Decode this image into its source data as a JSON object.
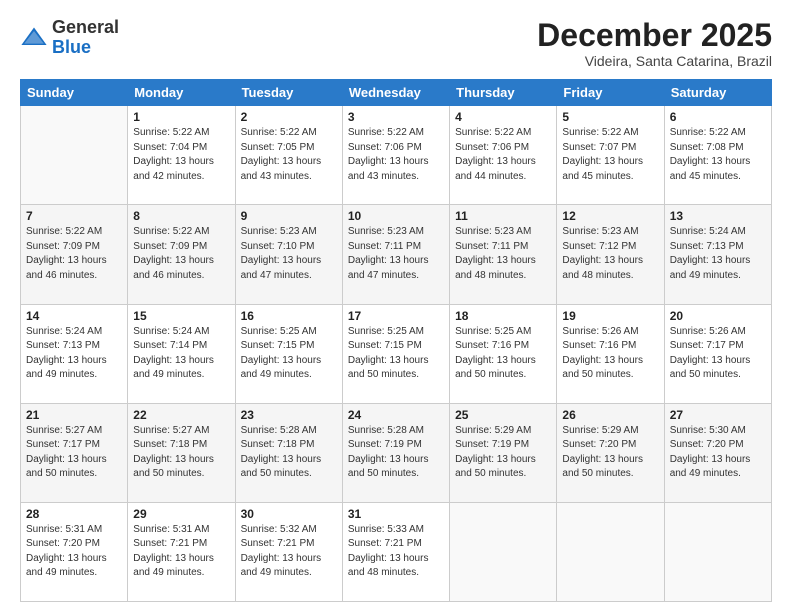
{
  "header": {
    "logo_general": "General",
    "logo_blue": "Blue",
    "month": "December 2025",
    "location": "Videira, Santa Catarina, Brazil"
  },
  "weekdays": [
    "Sunday",
    "Monday",
    "Tuesday",
    "Wednesday",
    "Thursday",
    "Friday",
    "Saturday"
  ],
  "weeks": [
    [
      {
        "day": "",
        "info": ""
      },
      {
        "day": "1",
        "info": "Sunrise: 5:22 AM\nSunset: 7:04 PM\nDaylight: 13 hours\nand 42 minutes."
      },
      {
        "day": "2",
        "info": "Sunrise: 5:22 AM\nSunset: 7:05 PM\nDaylight: 13 hours\nand 43 minutes."
      },
      {
        "day": "3",
        "info": "Sunrise: 5:22 AM\nSunset: 7:06 PM\nDaylight: 13 hours\nand 43 minutes."
      },
      {
        "day": "4",
        "info": "Sunrise: 5:22 AM\nSunset: 7:06 PM\nDaylight: 13 hours\nand 44 minutes."
      },
      {
        "day": "5",
        "info": "Sunrise: 5:22 AM\nSunset: 7:07 PM\nDaylight: 13 hours\nand 45 minutes."
      },
      {
        "day": "6",
        "info": "Sunrise: 5:22 AM\nSunset: 7:08 PM\nDaylight: 13 hours\nand 45 minutes."
      }
    ],
    [
      {
        "day": "7",
        "info": "Sunrise: 5:22 AM\nSunset: 7:09 PM\nDaylight: 13 hours\nand 46 minutes."
      },
      {
        "day": "8",
        "info": "Sunrise: 5:22 AM\nSunset: 7:09 PM\nDaylight: 13 hours\nand 46 minutes."
      },
      {
        "day": "9",
        "info": "Sunrise: 5:23 AM\nSunset: 7:10 PM\nDaylight: 13 hours\nand 47 minutes."
      },
      {
        "day": "10",
        "info": "Sunrise: 5:23 AM\nSunset: 7:11 PM\nDaylight: 13 hours\nand 47 minutes."
      },
      {
        "day": "11",
        "info": "Sunrise: 5:23 AM\nSunset: 7:11 PM\nDaylight: 13 hours\nand 48 minutes."
      },
      {
        "day": "12",
        "info": "Sunrise: 5:23 AM\nSunset: 7:12 PM\nDaylight: 13 hours\nand 48 minutes."
      },
      {
        "day": "13",
        "info": "Sunrise: 5:24 AM\nSunset: 7:13 PM\nDaylight: 13 hours\nand 49 minutes."
      }
    ],
    [
      {
        "day": "14",
        "info": "Sunrise: 5:24 AM\nSunset: 7:13 PM\nDaylight: 13 hours\nand 49 minutes."
      },
      {
        "day": "15",
        "info": "Sunrise: 5:24 AM\nSunset: 7:14 PM\nDaylight: 13 hours\nand 49 minutes."
      },
      {
        "day": "16",
        "info": "Sunrise: 5:25 AM\nSunset: 7:15 PM\nDaylight: 13 hours\nand 49 minutes."
      },
      {
        "day": "17",
        "info": "Sunrise: 5:25 AM\nSunset: 7:15 PM\nDaylight: 13 hours\nand 50 minutes."
      },
      {
        "day": "18",
        "info": "Sunrise: 5:25 AM\nSunset: 7:16 PM\nDaylight: 13 hours\nand 50 minutes."
      },
      {
        "day": "19",
        "info": "Sunrise: 5:26 AM\nSunset: 7:16 PM\nDaylight: 13 hours\nand 50 minutes."
      },
      {
        "day": "20",
        "info": "Sunrise: 5:26 AM\nSunset: 7:17 PM\nDaylight: 13 hours\nand 50 minutes."
      }
    ],
    [
      {
        "day": "21",
        "info": "Sunrise: 5:27 AM\nSunset: 7:17 PM\nDaylight: 13 hours\nand 50 minutes."
      },
      {
        "day": "22",
        "info": "Sunrise: 5:27 AM\nSunset: 7:18 PM\nDaylight: 13 hours\nand 50 minutes."
      },
      {
        "day": "23",
        "info": "Sunrise: 5:28 AM\nSunset: 7:18 PM\nDaylight: 13 hours\nand 50 minutes."
      },
      {
        "day": "24",
        "info": "Sunrise: 5:28 AM\nSunset: 7:19 PM\nDaylight: 13 hours\nand 50 minutes."
      },
      {
        "day": "25",
        "info": "Sunrise: 5:29 AM\nSunset: 7:19 PM\nDaylight: 13 hours\nand 50 minutes."
      },
      {
        "day": "26",
        "info": "Sunrise: 5:29 AM\nSunset: 7:20 PM\nDaylight: 13 hours\nand 50 minutes."
      },
      {
        "day": "27",
        "info": "Sunrise: 5:30 AM\nSunset: 7:20 PM\nDaylight: 13 hours\nand 49 minutes."
      }
    ],
    [
      {
        "day": "28",
        "info": "Sunrise: 5:31 AM\nSunset: 7:20 PM\nDaylight: 13 hours\nand 49 minutes."
      },
      {
        "day": "29",
        "info": "Sunrise: 5:31 AM\nSunset: 7:21 PM\nDaylight: 13 hours\nand 49 minutes."
      },
      {
        "day": "30",
        "info": "Sunrise: 5:32 AM\nSunset: 7:21 PM\nDaylight: 13 hours\nand 49 minutes."
      },
      {
        "day": "31",
        "info": "Sunrise: 5:33 AM\nSunset: 7:21 PM\nDaylight: 13 hours\nand 48 minutes."
      },
      {
        "day": "",
        "info": ""
      },
      {
        "day": "",
        "info": ""
      },
      {
        "day": "",
        "info": ""
      }
    ]
  ]
}
